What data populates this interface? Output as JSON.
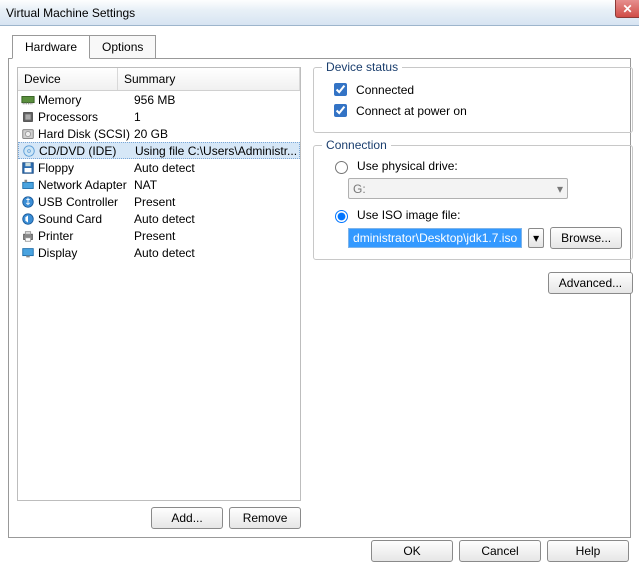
{
  "window": {
    "title": "Virtual Machine Settings"
  },
  "tabs": {
    "hardware": "Hardware",
    "options": "Options"
  },
  "table": {
    "headers": {
      "device": "Device",
      "summary": "Summary"
    },
    "rows": [
      {
        "icon": "memory-icon",
        "device": "Memory",
        "summary": "956 MB",
        "selected": false
      },
      {
        "icon": "cpu-icon",
        "device": "Processors",
        "summary": "1",
        "selected": false
      },
      {
        "icon": "hdd-icon",
        "device": "Hard Disk (SCSI)",
        "summary": "20 GB",
        "selected": false
      },
      {
        "icon": "cd-icon",
        "device": "CD/DVD (IDE)",
        "summary": "Using file C:\\Users\\Administr...",
        "selected": true
      },
      {
        "icon": "floppy-icon",
        "device": "Floppy",
        "summary": "Auto detect",
        "selected": false
      },
      {
        "icon": "nic-icon",
        "device": "Network Adapter",
        "summary": "NAT",
        "selected": false
      },
      {
        "icon": "usb-icon",
        "device": "USB Controller",
        "summary": "Present",
        "selected": false
      },
      {
        "icon": "sound-icon",
        "device": "Sound Card",
        "summary": "Auto detect",
        "selected": false
      },
      {
        "icon": "printer-icon",
        "device": "Printer",
        "summary": "Present",
        "selected": false
      },
      {
        "icon": "display-icon",
        "device": "Display",
        "summary": "Auto detect",
        "selected": false
      }
    ]
  },
  "buttons": {
    "add": "Add...",
    "remove": "Remove",
    "browse": "Browse...",
    "advanced": "Advanced...",
    "ok": "OK",
    "cancel": "Cancel",
    "help": "Help"
  },
  "deviceStatus": {
    "legend": "Device status",
    "connected": {
      "label": "Connected",
      "checked": true
    },
    "connectAtPowerOn": {
      "label": "Connect at power on",
      "checked": true
    }
  },
  "connection": {
    "legend": "Connection",
    "usePhysical": {
      "label": "Use physical drive:",
      "selected": false
    },
    "physicalDrive": "G:",
    "useIso": {
      "label": "Use ISO image file:",
      "selected": true
    },
    "isoPath": "dministrator\\Desktop\\jdk1.7.iso"
  }
}
